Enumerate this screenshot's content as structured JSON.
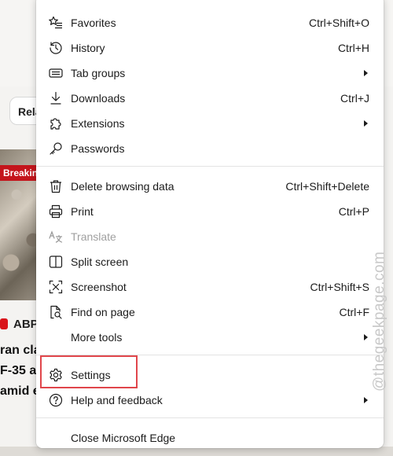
{
  "background": {
    "related_chip": "Rela",
    "breaking_badge": "Breakin",
    "source_name": "ABP",
    "headline_lines": [
      "ran cla",
      "F-35 a",
      "amid e"
    ]
  },
  "menu": {
    "items": [
      {
        "label": "Favorites",
        "shortcut": "Ctrl+Shift+O",
        "icon": "star-list-icon"
      },
      {
        "label": "History",
        "shortcut": "Ctrl+H",
        "icon": "history-icon"
      },
      {
        "label": "Tab groups",
        "submenu": true,
        "icon": "tab-groups-icon"
      },
      {
        "label": "Downloads",
        "shortcut": "Ctrl+J",
        "icon": "download-icon"
      },
      {
        "label": "Extensions",
        "submenu": true,
        "icon": "puzzle-icon"
      },
      {
        "label": "Passwords",
        "icon": "key-icon"
      },
      {
        "label": "Delete browsing data",
        "shortcut": "Ctrl+Shift+Delete",
        "icon": "trash-icon"
      },
      {
        "label": "Print",
        "shortcut": "Ctrl+P",
        "icon": "printer-icon"
      },
      {
        "label": "Translate",
        "disabled": true,
        "icon": "translate-icon"
      },
      {
        "label": "Split screen",
        "icon": "split-screen-icon"
      },
      {
        "label": "Screenshot",
        "shortcut": "Ctrl+Shift+S",
        "icon": "screenshot-icon"
      },
      {
        "label": "Find on page",
        "shortcut": "Ctrl+F",
        "icon": "find-on-page-icon"
      },
      {
        "label": "More tools",
        "submenu": true
      },
      {
        "label": "Settings",
        "icon": "gear-icon",
        "highlighted": true
      },
      {
        "label": "Help and feedback",
        "submenu": true,
        "icon": "help-icon"
      },
      {
        "label": "Close Microsoft Edge"
      }
    ]
  },
  "watermark": "@thegeekpage.com",
  "colors": {
    "highlight": "#e0464b",
    "breaking": "#c4151c"
  }
}
